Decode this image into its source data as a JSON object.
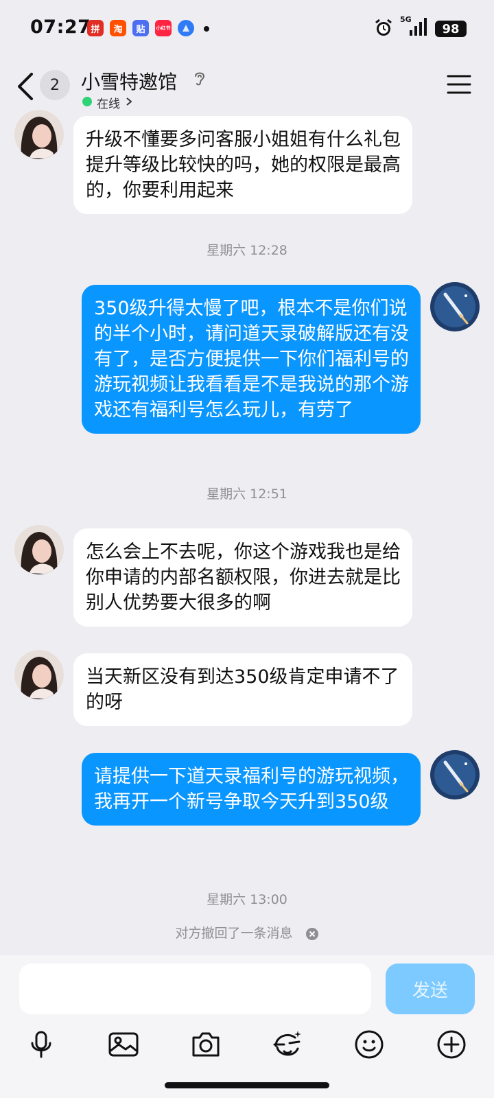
{
  "status_bar": {
    "time": "07:27",
    "network": "5G",
    "battery": "98",
    "app_icons": [
      {
        "name": "pinduoduo-icon",
        "glyph": "拼",
        "color": "#e02e24"
      },
      {
        "name": "taobao-icon",
        "glyph": "淘",
        "color": "#ff5000"
      },
      {
        "name": "tieba-icon",
        "glyph": "贴",
        "color": "#4e6ef2"
      },
      {
        "name": "xiaohongshu-icon",
        "glyph": "小红书",
        "color": "#ff2442"
      },
      {
        "name": "browser-icon",
        "glyph": "",
        "color": "#2f7bf5"
      }
    ]
  },
  "header": {
    "unread_count": "2",
    "title": "小雪特邀馆",
    "status": "在线"
  },
  "messages": [
    {
      "dir": "in",
      "text": "升级不懂要多问客服小姐姐有什么礼包提升等级比较快的吗，她的权限是最高的，你要利用起来"
    },
    {
      "type": "time",
      "text": "星期六 12:28"
    },
    {
      "dir": "out",
      "text": "350级升得太慢了吧，根本不是你们说的半个小时，请问道天录破解版还有没有了，是否方便提供一下你们福利号的游玩视频让我看看是不是我说的那个游戏还有福利号怎么玩儿，有劳了"
    },
    {
      "type": "time",
      "text": "星期六 12:51"
    },
    {
      "dir": "in",
      "text": "怎么会上不去呢，你这个游戏我也是给你申请的内部名额权限，你进去就是比别人优势要大很多的啊"
    },
    {
      "dir": "in",
      "text": "当天新区没有到达350级肯定申请不了的呀"
    },
    {
      "dir": "out",
      "text": "请提供一下道天录福利号的游玩视频，我再开一个新号争取今天升到350级"
    },
    {
      "type": "time",
      "text": "星期六 13:00"
    },
    {
      "type": "recall",
      "text": "对方撤回了一条消息"
    }
  ],
  "input": {
    "placeholder": "",
    "value": "",
    "send_label": "发送"
  },
  "toolbar": [
    "microphone-icon",
    "image-icon",
    "camera-icon",
    "sticker-icon",
    "emoji-icon",
    "plus-icon"
  ],
  "colors": {
    "background": "#eeeef2",
    "incoming_bubble": "#ffffff",
    "outgoing_bubble": "#0a96ff",
    "send_button": "#7ccaff",
    "online": "#2fd275"
  }
}
